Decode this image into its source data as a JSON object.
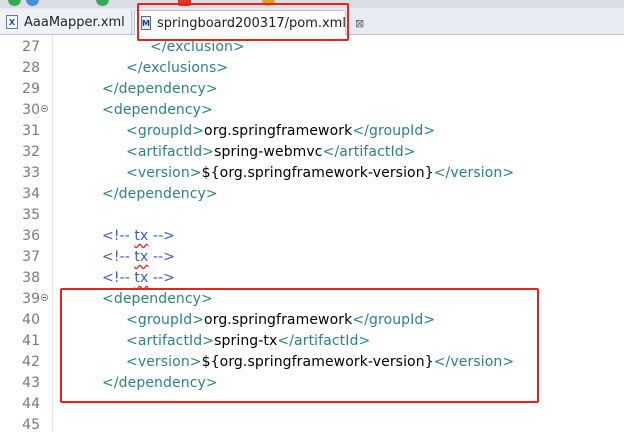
{
  "tabs": [
    {
      "label": "AaaMapper.xml",
      "icon": "xml-file-icon",
      "active": false
    },
    {
      "label": "springboard200317/pom.xml",
      "icon": "maven-pom-icon",
      "active": true,
      "close_glyph": "⊠"
    }
  ],
  "lines": [
    {
      "n": "27",
      "indent": 2,
      "parts": [
        {
          "t": "</exclusion>",
          "c": "tag"
        }
      ]
    },
    {
      "n": "28",
      "indent": 1,
      "parts": [
        {
          "t": "</exclusions>",
          "c": "tag"
        }
      ]
    },
    {
      "n": "29",
      "indent": 0,
      "parts": [
        {
          "t": "</dependency>",
          "c": "tag"
        }
      ]
    },
    {
      "n": "30",
      "indent": 0,
      "fold": true,
      "parts": [
        {
          "t": "<dependency>",
          "c": "tag"
        }
      ]
    },
    {
      "n": "31",
      "indent": 1,
      "parts": [
        {
          "t": "<groupId>",
          "c": "tag"
        },
        {
          "t": "org.springframework",
          "c": "txt"
        },
        {
          "t": "</groupId>",
          "c": "tag"
        }
      ]
    },
    {
      "n": "32",
      "indent": 1,
      "parts": [
        {
          "t": "<artifactId>",
          "c": "tag"
        },
        {
          "t": "spring-webmvc",
          "c": "txt"
        },
        {
          "t": "</artifactId>",
          "c": "tag"
        }
      ]
    },
    {
      "n": "33",
      "indent": 1,
      "parts": [
        {
          "t": "<version>",
          "c": "tag"
        },
        {
          "t": "${org.springframework-version}",
          "c": "txt"
        },
        {
          "t": "</version>",
          "c": "tag"
        }
      ]
    },
    {
      "n": "34",
      "indent": 0,
      "parts": [
        {
          "t": "</dependency>",
          "c": "tag"
        }
      ]
    },
    {
      "n": "35",
      "indent": 0,
      "parts": []
    },
    {
      "n": "36",
      "indent": 0,
      "parts": [
        {
          "t": "<!-- ",
          "c": "cmt"
        },
        {
          "t": "tx",
          "c": "cmt squig"
        },
        {
          "t": " -->",
          "c": "cmt"
        }
      ]
    },
    {
      "n": "37",
      "indent": 0,
      "parts": [
        {
          "t": "<!-- ",
          "c": "cmt"
        },
        {
          "t": "tx",
          "c": "cmt squig"
        },
        {
          "t": " -->",
          "c": "cmt"
        }
      ]
    },
    {
      "n": "38",
      "indent": 0,
      "parts": [
        {
          "t": "<!-- ",
          "c": "cmt"
        },
        {
          "t": "tx",
          "c": "cmt squig"
        },
        {
          "t": " -->",
          "c": "cmt"
        }
      ]
    },
    {
      "n": "39",
      "indent": 0,
      "fold": true,
      "parts": [
        {
          "t": "<dependency>",
          "c": "tag"
        }
      ]
    },
    {
      "n": "40",
      "indent": 1,
      "parts": [
        {
          "t": "<groupId>",
          "c": "tag"
        },
        {
          "t": "org.springframework",
          "c": "txt"
        },
        {
          "t": "</groupId>",
          "c": "tag"
        }
      ]
    },
    {
      "n": "41",
      "indent": 1,
      "parts": [
        {
          "t": "<artifactId>",
          "c": "tag"
        },
        {
          "t": "spring-tx",
          "c": "txt"
        },
        {
          "t": "</artifactId>",
          "c": "tag"
        }
      ]
    },
    {
      "n": "42",
      "indent": 1,
      "parts": [
        {
          "t": "<version>",
          "c": "tag"
        },
        {
          "t": "${org.springframework-version}",
          "c": "txt"
        },
        {
          "t": "</version>",
          "c": "tag"
        }
      ]
    },
    {
      "n": "43",
      "indent": 0,
      "parts": [
        {
          "t": "</dependency>",
          "c": "tag"
        }
      ]
    },
    {
      "n": "44",
      "indent": 0,
      "parts": []
    },
    {
      "n": "45",
      "indent": 0,
      "parts": []
    }
  ],
  "colors": {
    "tag": "#2d8286",
    "text": "#000000",
    "comment": "#3f5fbf",
    "annotation_box": "#e8221f"
  }
}
